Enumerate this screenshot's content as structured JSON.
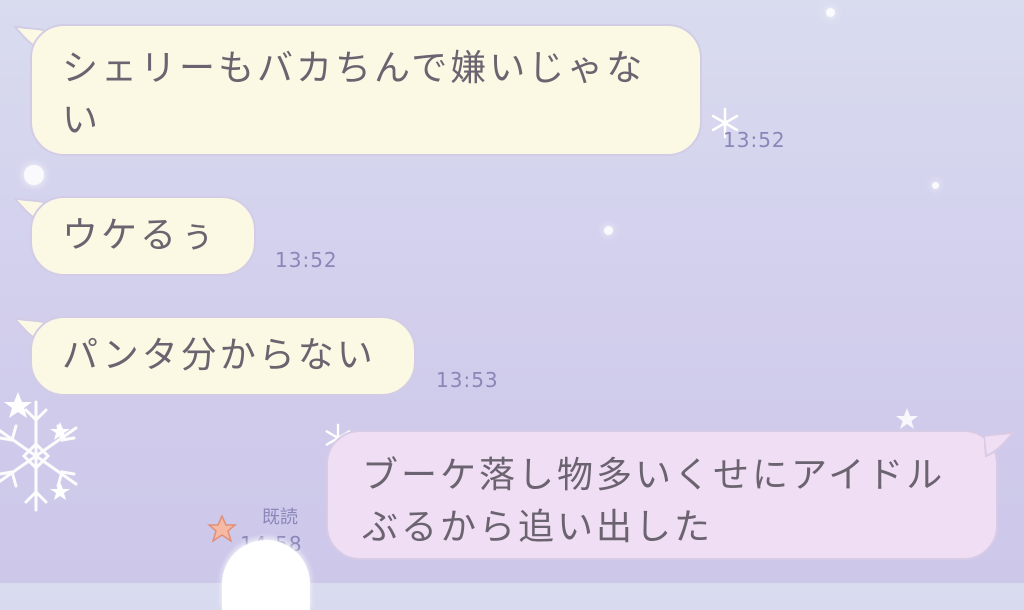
{
  "messages": [
    {
      "direction": "incoming",
      "text": "シェリーもバカちんで嫌いじゃな\nい",
      "time": "13:52"
    },
    {
      "direction": "incoming",
      "text": "ウケるぅ",
      "time": "13:52"
    },
    {
      "direction": "incoming",
      "text": "パンタ分からない",
      "time": "13:53"
    },
    {
      "direction": "outgoing",
      "text": "ブーケ落し物多いくせにアイドル\nぶるから追い出した",
      "time": "14:58",
      "read_label": "既読"
    }
  ],
  "colors": {
    "incoming_bubble": "#fbf9e3",
    "outgoing_bubble": "#f0dff4",
    "timestamp": "#8a86b8",
    "message_text": "#6b6470"
  }
}
